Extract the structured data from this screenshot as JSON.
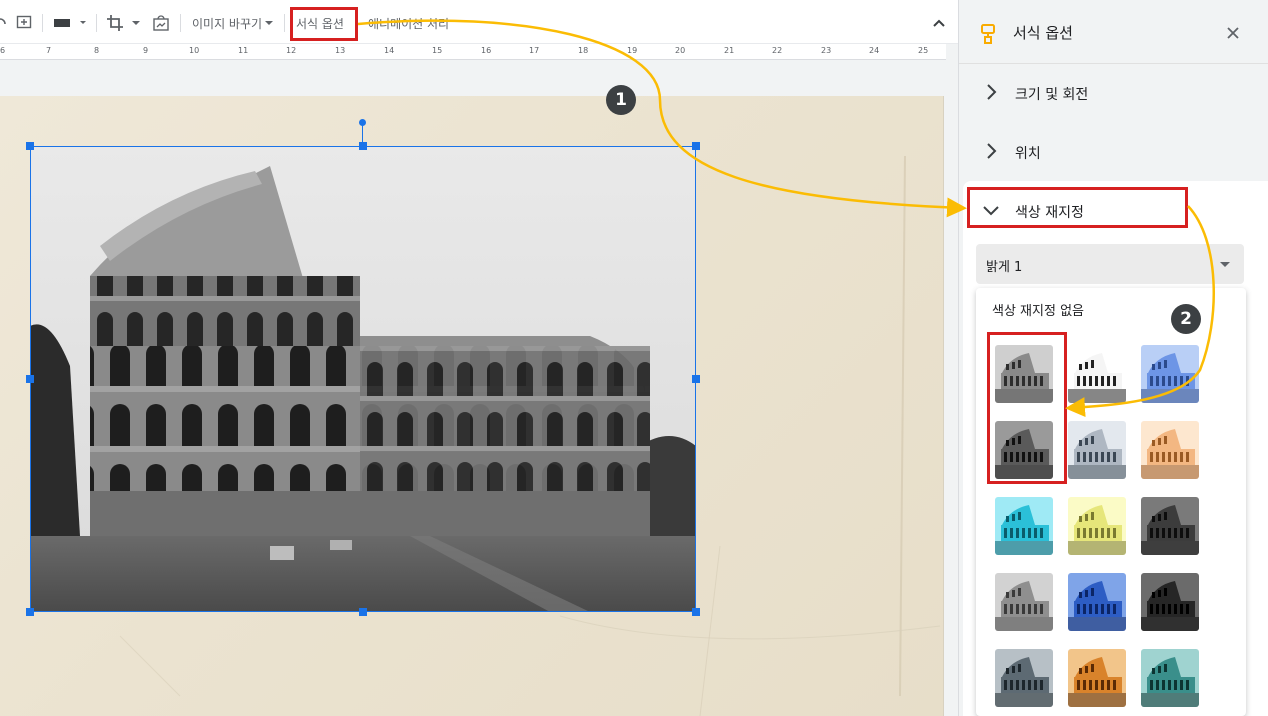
{
  "toolbar": {
    "replace_image_label": "이미지 바꾸기",
    "format_options_label": "서식 옵션",
    "animation_label": "애니메이션 처리"
  },
  "ruler": {
    "numbers": [
      "6",
      "7",
      "8",
      "9",
      "10",
      "11",
      "12",
      "13",
      "14",
      "15",
      "16",
      "17",
      "18",
      "19",
      "20",
      "21",
      "22",
      "23",
      "24",
      "25"
    ]
  },
  "panel": {
    "title": "서식 옵션",
    "sections": {
      "size_rotation": "크기 및 회전",
      "position": "위치",
      "recolor": "색상 재지정"
    },
    "recolor_dropdown_value": "밝게 1",
    "recolor_menu_label": "색상 재지정 없음",
    "accent_color": "#f9ab00"
  },
  "annotations": {
    "step1": "1",
    "step2": "2",
    "arrow_color": "#fbbc04",
    "highlight_color": "#d62020"
  },
  "recolor_swatches": [
    [
      "grayscale-light",
      "bw-high",
      "blue-light"
    ],
    [
      "grayscale-dark",
      "bluegray-light",
      "orange-light"
    ],
    [
      "cyan",
      "yellow",
      "dark-gray"
    ],
    [
      "gray",
      "blue-dark",
      "black"
    ],
    [
      "slate",
      "orange-dark",
      "teal-dark"
    ]
  ]
}
